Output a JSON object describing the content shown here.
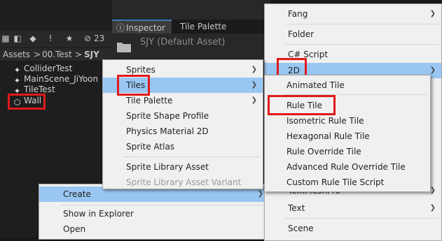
{
  "project": {
    "toolbar_count": "23",
    "breadcrumb": [
      "Assets",
      "00.Test",
      "SJY"
    ],
    "breadcrumb_sep": ">",
    "assets": [
      {
        "label": "ColliderTest",
        "icon": "unity-scene-icon"
      },
      {
        "label": "MainScene_JiYoon",
        "icon": "unity-scene-icon"
      },
      {
        "label": "TileTest",
        "icon": "unity-scene-icon"
      },
      {
        "label": "Wall",
        "icon": "prefab-cube-icon"
      }
    ]
  },
  "inspector": {
    "tab_inspector": "Inspector",
    "tab_tile_palette": "Tile Palette",
    "title": "SJY (Default Asset)"
  },
  "context_menu": {
    "items": [
      "Create",
      "Show in Explorer",
      "Open"
    ]
  },
  "sprites_menu": {
    "items": [
      {
        "label": "Sprites",
        "submenu": true,
        "disabled": false
      },
      {
        "label": "Tiles",
        "submenu": true,
        "disabled": false
      },
      {
        "label": "Tile Palette",
        "submenu": true,
        "disabled": false
      },
      {
        "label": "Sprite Shape Profile",
        "submenu": false,
        "disabled": false
      },
      {
        "label": "Physics Material 2D",
        "submenu": false,
        "disabled": false
      },
      {
        "label": "Sprite Atlas",
        "submenu": false,
        "disabled": false
      },
      {
        "label": "Sprite Library Asset",
        "submenu": false,
        "disabled": false
      },
      {
        "label": "Sprite Library Asset Variant",
        "submenu": false,
        "disabled": true
      }
    ]
  },
  "create_menu": {
    "items": [
      "Fang",
      "Folder",
      "C# Script",
      "2D",
      "TextMeshPro",
      "Text",
      "Scene"
    ]
  },
  "tiles_menu": {
    "items": [
      "Animated Tile",
      "Rule Tile",
      "Isometric Rule Tile",
      "Hexagonal Rule Tile",
      "Rule Override Tile",
      "Advanced Rule Override Tile",
      "Custom Rule Tile Script"
    ]
  },
  "colors": {
    "highlight": "#99c6f2",
    "menu_bg": "#f0f0f0",
    "annotation_red": "#e01a1a"
  }
}
